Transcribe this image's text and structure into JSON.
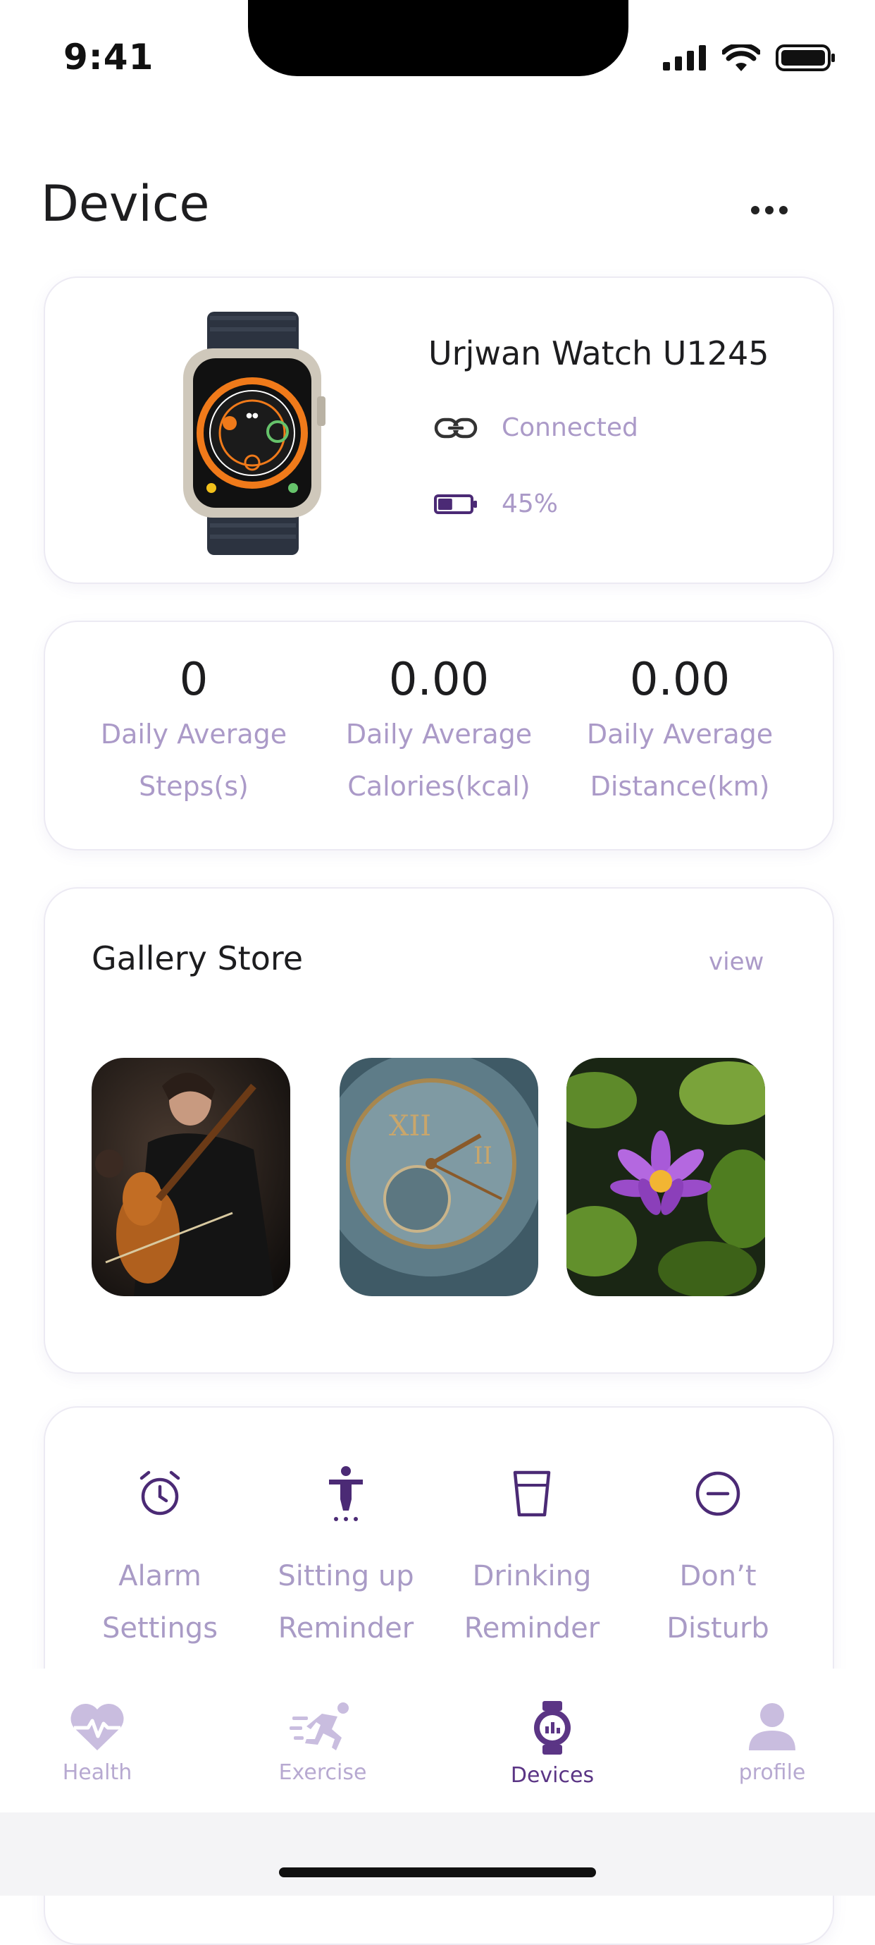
{
  "status_bar": {
    "time": "9:41",
    "icons": [
      "signal-icon",
      "wifi-icon",
      "battery-icon"
    ]
  },
  "header": {
    "title": "Device",
    "more_icon": "more-icon"
  },
  "device": {
    "name": "Urjwan Watch U1245",
    "connection_status": "Connected",
    "battery_level": "45%",
    "battery_fraction": 0.45
  },
  "stats": [
    {
      "value": "0",
      "label": "Daily Average\nSteps(s)"
    },
    {
      "value": "0.00",
      "label": "Daily Average\nCalories(kcal)"
    },
    {
      "value": "0.00",
      "label": "Daily Average\nDistance(km)"
    }
  ],
  "gallery": {
    "title": "Gallery Store",
    "view_label": "view",
    "items": [
      {
        "subject": "cellist photo"
      },
      {
        "subject": "pocket watch photo"
      },
      {
        "subject": "purple water lily photo"
      }
    ]
  },
  "settings": [
    {
      "label": "Alarm\nSettings",
      "icon": "alarm-icon"
    },
    {
      "label": "Sitting up\nReminder",
      "icon": "standing-person-icon"
    },
    {
      "label": "Drinking\nReminder",
      "icon": "cup-icon"
    },
    {
      "label": "Don’t\nDisturb",
      "icon": "minus-circle-icon"
    }
  ],
  "tabs": [
    {
      "label": "Health",
      "icon": "heart-icon",
      "active": false
    },
    {
      "label": "Exercise",
      "icon": "running-icon",
      "active": false
    },
    {
      "label": "Devices",
      "icon": "watch-icon",
      "active": true
    },
    {
      "label": "profile",
      "icon": "user-icon",
      "active": false
    }
  ],
  "colors": {
    "accent": "#5b3585",
    "muted": "#ab9ac8",
    "card_border": "#eceaf3"
  }
}
